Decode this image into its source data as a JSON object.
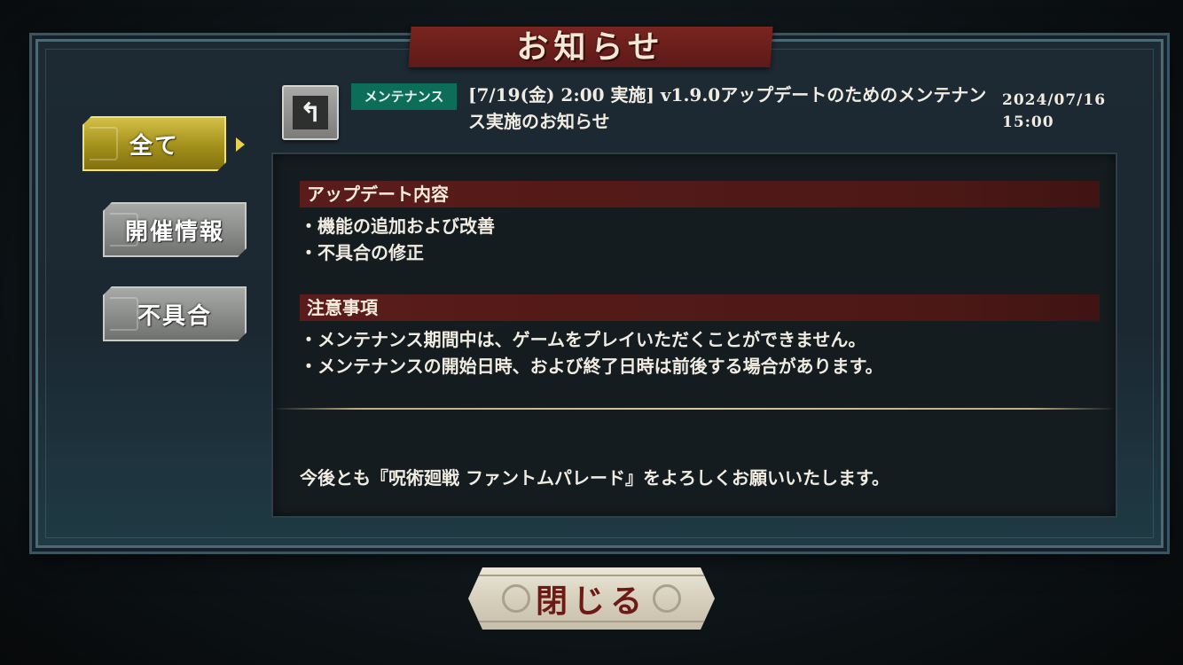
{
  "window": {
    "title": "お知らせ"
  },
  "sidebar": {
    "tabs": [
      {
        "label": "全て",
        "active": true
      },
      {
        "label": "開催情報",
        "active": false
      },
      {
        "label": "不具合",
        "active": false
      }
    ]
  },
  "notice": {
    "category": "メンテナンス",
    "headline": "[7/19(金) 2:00 実施] v1.9.0アップデートのためのメンテナンス実施のお知らせ",
    "date": "2024/07/16",
    "time": "15:00",
    "sections": [
      {
        "heading": "アップデート内容",
        "items": [
          "・機能の追加および改善",
          "・不具合の修正"
        ]
      },
      {
        "heading": "注意事項",
        "items": [
          "・メンテナンス期間中は、ゲームをプレイいただくことができません。",
          "・メンテナンスの開始日時、および終了日時は前後する場合があります。"
        ]
      }
    ],
    "footer": "今後とも『呪術廻戦 ファントムパレード』をよろしくお願いいたします。"
  },
  "buttons": {
    "close_label": "閉じる",
    "back_icon": "back-arrow-icon"
  },
  "colors": {
    "badge": "#0c6e58",
    "section_bar": "#5a1c1a",
    "active_tab": "#c9b43a",
    "title_banner": "#7a2420",
    "close_text": "#6b1a16"
  }
}
